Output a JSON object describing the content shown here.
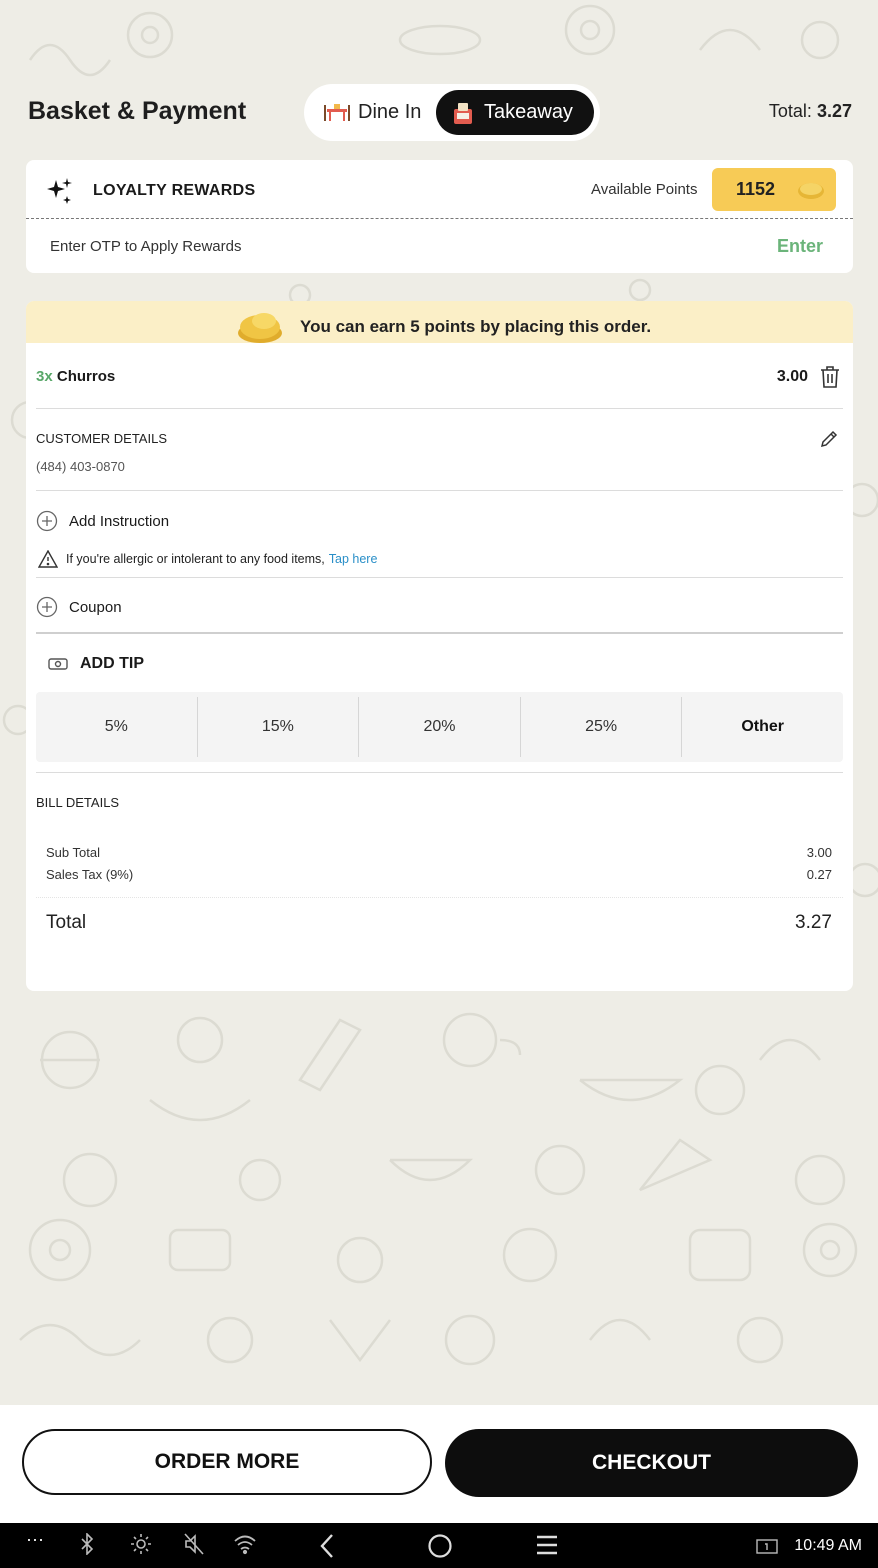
{
  "header": {
    "title": "Basket & Payment",
    "dine_in_label": "Dine In",
    "takeaway_label": "Takeaway",
    "total_label": "Total:",
    "total_value": "3.27"
  },
  "loyalty": {
    "title": "LOYALTY REWARDS",
    "available_label": "Available Points",
    "points": "1152",
    "otp_prompt": "Enter OTP to Apply Rewards",
    "enter_label": "Enter"
  },
  "earn_banner": "You can earn 5 points by placing this order.",
  "item": {
    "qty": "3x",
    "name": "Churros",
    "price": "3.00"
  },
  "customer": {
    "label": "CUSTOMER DETAILS",
    "phone": "(484) 403-0870"
  },
  "instruction": {
    "add_label": "Add Instruction",
    "allergy_text": "If you're allergic or intolerant to any food items,",
    "tap_label": "Tap here"
  },
  "coupon_label": "Coupon",
  "tip": {
    "label": "ADD TIP",
    "options": [
      "5%",
      "15%",
      "20%",
      "25%",
      "Other"
    ]
  },
  "bill": {
    "label": "BILL DETAILS",
    "subtotal_label": "Sub Total",
    "subtotal_value": "3.00",
    "tax_label": "Sales Tax (9%)",
    "tax_value": "0.27",
    "total_label": "Total",
    "total_value": "3.27"
  },
  "actions": {
    "order_more": "ORDER MORE",
    "checkout": "CHECKOUT"
  },
  "system": {
    "time": "10:49 AM",
    "dots": "···"
  },
  "colors": {
    "accent_green": "#6bb47a",
    "points_yellow": "#f7cb56",
    "link_blue": "#2a8fc8"
  }
}
